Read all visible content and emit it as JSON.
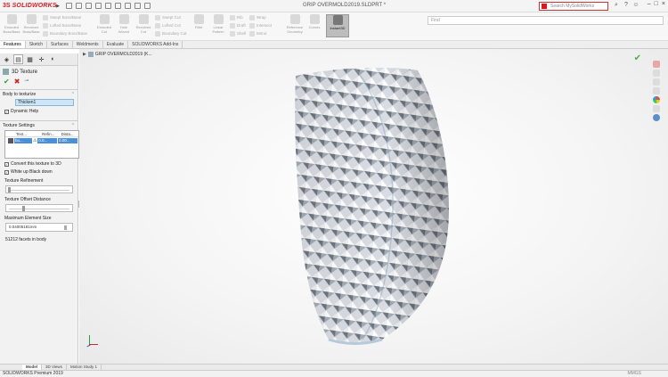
{
  "app": {
    "logo_text": "SOLIDWORKS",
    "document_title": "GRIP OVERMOLD2019.SLDPRT *",
    "search_placeholder": "Search MySolidWorks"
  },
  "ribbon": {
    "group1": [
      {
        "label": "Extruded Boss/Base"
      },
      {
        "label": "Revolved Boss/Base"
      }
    ],
    "group1_small": [
      "Swept Boss/Base",
      "Lofted Boss/Base",
      "Boundary Boss/Base"
    ],
    "group2": [
      {
        "label": "Extruded Cut"
      },
      {
        "label": "Hole Wizard"
      },
      {
        "label": "Revolved Cut"
      }
    ],
    "group2_small": [
      "Swept Cut",
      "Lofted Cut",
      "Boundary Cut"
    ],
    "group3": [
      {
        "label": "Fillet"
      },
      {
        "label": "Linear Pattern"
      }
    ],
    "group3_small": [
      "Rib",
      "Draft",
      "Shell"
    ],
    "group4_small": [
      "Wrap",
      "Intersect",
      "Mirror"
    ],
    "group5": [
      {
        "label": "Reference Geometry"
      },
      {
        "label": "Curves"
      },
      {
        "label": "Instant3D"
      }
    ],
    "find_placeholder": "Find"
  },
  "command_tabs": [
    "Features",
    "Sketch",
    "Surfaces",
    "Weldments",
    "Evaluate",
    "SOLIDWORKS Add-Ins"
  ],
  "property_manager": {
    "title": "3D Texture",
    "body_section": "Body to texturize",
    "body_value": "Thicken1",
    "dynamic_help": "Dynamic Help",
    "texture_settings": "Texture Settings",
    "table_headers": [
      "Text...",
      "Refin...",
      "Dista..."
    ],
    "table_row": [
      "bu...",
      "0.0...",
      "0.00..."
    ],
    "convert_label": "Convert this texture to 3D",
    "white_label": "White up Black down",
    "refinement_label": "Texture Refinement",
    "offset_label": "Texture Offset Distance",
    "max_element_label": "Maximum Element Size",
    "max_element_value": "0.04005181mm",
    "facets_text": "51212 facets in body"
  },
  "viewport": {
    "breadcrumb": "GRIP OVERMOLD2019 (K..."
  },
  "bottom_tabs": [
    "Model",
    "3D Views",
    "Motion Study 1"
  ],
  "status": {
    "left": "SOLIDWORKS Premium 2019",
    "right": "MMGS"
  },
  "colors": {
    "brand": "#d71920",
    "accept": "#2a9d2a",
    "cancel": "#cc2222",
    "selection": "#4a90d9"
  }
}
